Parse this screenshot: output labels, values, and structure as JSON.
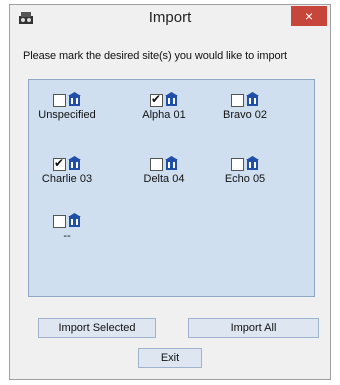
{
  "window": {
    "title": "Import",
    "close_label": "×"
  },
  "prompt": "Please mark the desired site(s) you would like to import",
  "sites": [
    {
      "name": "Unspecified",
      "checked": false,
      "icon": "building-icon"
    },
    {
      "name": "Alpha 01",
      "checked": true,
      "icon": "building-icon"
    },
    {
      "name": "Bravo 02",
      "checked": false,
      "icon": "building-icon"
    },
    {
      "name": "Charlie 03",
      "checked": true,
      "icon": "building-icon"
    },
    {
      "name": "Delta 04",
      "checked": false,
      "icon": "building-icon"
    },
    {
      "name": "Echo 05",
      "checked": false,
      "icon": "building-icon"
    },
    {
      "name": "--",
      "checked": false,
      "icon": "building-icon"
    }
  ],
  "buttons": {
    "import_selected": "Import Selected",
    "import_all": "Import All",
    "exit": "Exit"
  },
  "colors": {
    "close": "#c7463c",
    "panel": "#cfdff0",
    "icon": "#1f4fa8"
  }
}
